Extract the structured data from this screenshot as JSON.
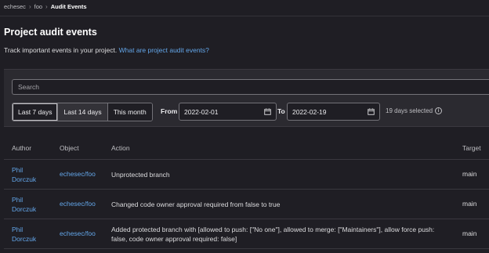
{
  "breadcrumb": {
    "items": [
      "echesec",
      "foo"
    ],
    "current": "Audit Events"
  },
  "page": {
    "title": "Project audit events",
    "description": "Track important events in your project.",
    "help_link": "What are project audit events?"
  },
  "filters": {
    "search_placeholder": "Search",
    "ranges": [
      "Last 7 days",
      "Last 14 days",
      "This month"
    ],
    "active_range": "Last 7 days",
    "from_label": "From",
    "from_value": "2022-02-01",
    "to_label": "To",
    "to_value": "2022-02-19",
    "days_selected": "19 days selected"
  },
  "table": {
    "columns": {
      "author": "Author",
      "object": "Object",
      "action": "Action",
      "target": "Target"
    },
    "rows": [
      {
        "author": "Phil Dorczuk",
        "object": "echesec/foo",
        "action": "Unprotected branch",
        "target": "main"
      },
      {
        "author": "Phil Dorczuk",
        "object": "echesec/foo",
        "action": "Changed code owner approval required from false to true",
        "target": "main"
      },
      {
        "author": "Phil Dorczuk",
        "object": "echesec/foo",
        "action": "Added protected branch with [allowed to push: [\"No one\"], allowed to merge: [\"Maintainers\"], allow force push: false, code owner approval required: false]",
        "target": "main"
      }
    ]
  },
  "colors": {
    "link": "#63a6e9",
    "background": "#1f1e24"
  }
}
